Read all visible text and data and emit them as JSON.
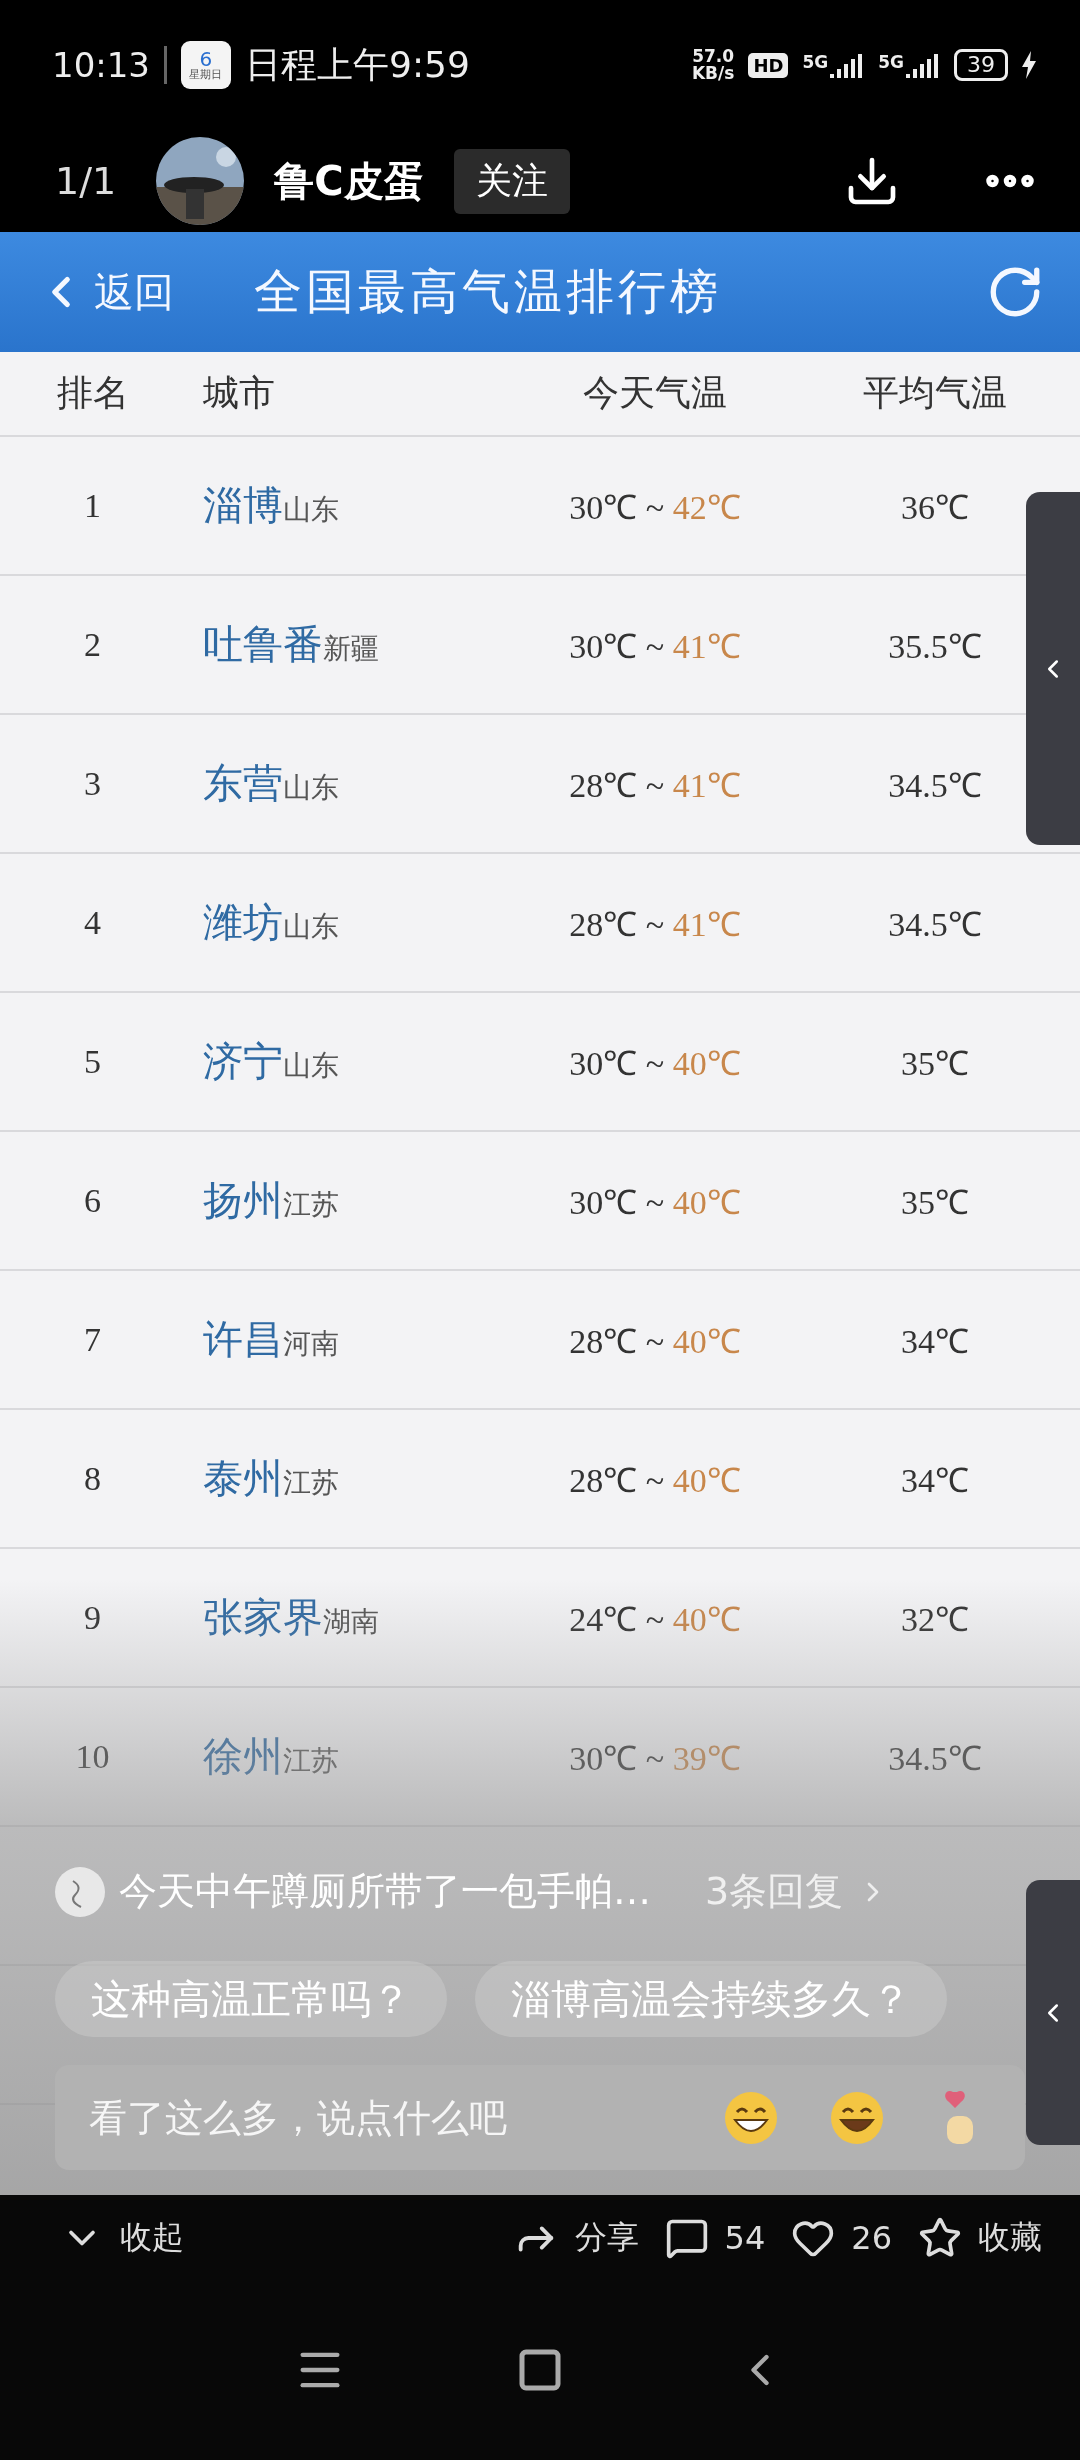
{
  "status_bar": {
    "time": "10:13",
    "calendar_day": "6",
    "calendar_weekday": "星期日",
    "notification": "日程上午9:59",
    "net_speed": [
      "57.0",
      "KB/s"
    ],
    "hd": "HD",
    "networks": [
      "5G",
      "5G"
    ],
    "battery": "39"
  },
  "post_header": {
    "counter": "1/1",
    "author": "鲁C皮蛋",
    "follow": "关注"
  },
  "app_bar": {
    "back": "返回",
    "title": "全国最高气温排行榜"
  },
  "table": {
    "columns": [
      "排名",
      "城市",
      "今天气温",
      "平均气温"
    ],
    "separator": "~",
    "rows": [
      {
        "rank": "1",
        "city": "淄博",
        "province": "山东",
        "low": "30℃",
        "high": "42℃",
        "average": "36℃"
      },
      {
        "rank": "2",
        "city": "吐鲁番",
        "province": "新疆",
        "low": "30℃",
        "high": "41℃",
        "average": "35.5℃"
      },
      {
        "rank": "3",
        "city": "东营",
        "province": "山东",
        "low": "28℃",
        "high": "41℃",
        "average": "34.5℃"
      },
      {
        "rank": "4",
        "city": "潍坊",
        "province": "山东",
        "low": "28℃",
        "high": "41℃",
        "average": "34.5℃"
      },
      {
        "rank": "5",
        "city": "济宁",
        "province": "山东",
        "low": "30℃",
        "high": "40℃",
        "average": "35℃"
      },
      {
        "rank": "6",
        "city": "扬州",
        "province": "江苏",
        "low": "30℃",
        "high": "40℃",
        "average": "35℃"
      },
      {
        "rank": "7",
        "city": "许昌",
        "province": "河南",
        "low": "28℃",
        "high": "40℃",
        "average": "34℃"
      },
      {
        "rank": "8",
        "city": "泰州",
        "province": "江苏",
        "low": "28℃",
        "high": "40℃",
        "average": "34℃"
      },
      {
        "rank": "9",
        "city": "张家界",
        "province": "湖南",
        "low": "24℃",
        "high": "40℃",
        "average": "32℃"
      },
      {
        "rank": "10",
        "city": "徐州",
        "province": "江苏",
        "low": "30℃",
        "high": "39℃",
        "average": "34.5℃"
      }
    ]
  },
  "comment_preview": {
    "text": "今天中午蹲厕所带了一包手帕…",
    "replies": "3条回复"
  },
  "suggestions": [
    "这种高温正常吗？",
    "淄博高温会持续多久？"
  ],
  "comment_input": {
    "placeholder": "看了这么多，说点什么吧"
  },
  "actions": {
    "collapse": "收起",
    "share": "分享",
    "comments": "54",
    "likes": "26",
    "favorite": "收藏"
  }
}
